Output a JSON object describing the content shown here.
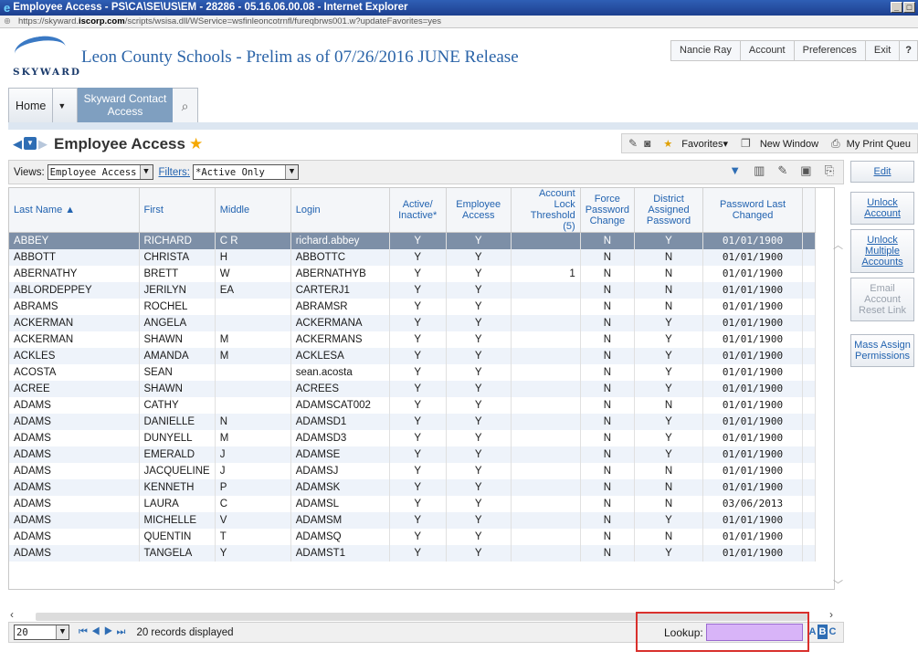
{
  "window": {
    "title": "Employee Access - PS\\CA\\SE\\US\\EM - 28286 - 05.16.06.00.08 - Internet Explorer"
  },
  "address": {
    "prefix": "https://skyward.",
    "domain": "iscorp.com",
    "path": "/scripts/wsisa.dll/WService=wsfinleoncotrnfl/fureqbrws001.w?updateFavorites=yes"
  },
  "brand": {
    "logo_text": "SKYWARD",
    "district": "Leon County Schools - Prelim as of 07/26/2016 JUNE Release"
  },
  "toplinks": {
    "user": "Nancie Ray",
    "account": "Account",
    "preferences": "Preferences",
    "exit": "Exit",
    "help": "?"
  },
  "nav": {
    "home": "Home",
    "tab": "Skyward Contact Access"
  },
  "page": {
    "title": "Employee Access"
  },
  "tools": {
    "favorites": "Favorites",
    "new_window": "New Window",
    "print_queue": "My Print Queu"
  },
  "views": {
    "views_label": "Views:",
    "view_value": "Employee Access",
    "filters_label": "Filters:",
    "filter_value": "*Active Only"
  },
  "columns": [
    "Last Name ▲",
    "First",
    "Middle",
    "Login",
    "Active/ Inactive*",
    "Employee Access",
    "Account Lock Threshold (5)",
    "Force Password Change",
    "District Assigned Password",
    "Password Last Changed"
  ],
  "rows": [
    [
      "ABBEY",
      "RICHARD",
      "C R",
      "richard.abbey",
      "Y",
      "Y",
      "",
      "N",
      "Y",
      "01/01/1900"
    ],
    [
      "ABBOTT",
      "CHRISTA",
      "H",
      "ABBOTTC",
      "Y",
      "Y",
      "",
      "N",
      "N",
      "01/01/1900"
    ],
    [
      "ABERNATHY",
      "BRETT",
      "W",
      "ABERNATHYB",
      "Y",
      "Y",
      "1",
      "N",
      "N",
      "01/01/1900"
    ],
    [
      "ABLORDEPPEY",
      "JERILYN",
      "EA",
      "CARTERJ1",
      "Y",
      "Y",
      "",
      "N",
      "N",
      "01/01/1900"
    ],
    [
      "ABRAMS",
      "ROCHEL",
      "",
      "ABRAMSR",
      "Y",
      "Y",
      "",
      "N",
      "N",
      "01/01/1900"
    ],
    [
      "ACKERMAN",
      "ANGELA",
      "",
      "ACKERMANA",
      "Y",
      "Y",
      "",
      "N",
      "Y",
      "01/01/1900"
    ],
    [
      "ACKERMAN",
      "SHAWN",
      "M",
      "ACKERMANS",
      "Y",
      "Y",
      "",
      "N",
      "Y",
      "01/01/1900"
    ],
    [
      "ACKLES",
      "AMANDA",
      "M",
      "ACKLESA",
      "Y",
      "Y",
      "",
      "N",
      "Y",
      "01/01/1900"
    ],
    [
      "ACOSTA",
      "SEAN",
      "",
      "sean.acosta",
      "Y",
      "Y",
      "",
      "N",
      "Y",
      "01/01/1900"
    ],
    [
      "ACREE",
      "SHAWN",
      "",
      "ACREES",
      "Y",
      "Y",
      "",
      "N",
      "Y",
      "01/01/1900"
    ],
    [
      "ADAMS",
      "CATHY",
      "",
      "ADAMSCAT002",
      "Y",
      "Y",
      "",
      "N",
      "N",
      "01/01/1900"
    ],
    [
      "ADAMS",
      "DANIELLE",
      "N",
      "ADAMSD1",
      "Y",
      "Y",
      "",
      "N",
      "Y",
      "01/01/1900"
    ],
    [
      "ADAMS",
      "DUNYELL",
      "M",
      "ADAMSD3",
      "Y",
      "Y",
      "",
      "N",
      "Y",
      "01/01/1900"
    ],
    [
      "ADAMS",
      "EMERALD",
      "J",
      "ADAMSE",
      "Y",
      "Y",
      "",
      "N",
      "Y",
      "01/01/1900"
    ],
    [
      "ADAMS",
      "JACQUELINE",
      "J",
      "ADAMSJ",
      "Y",
      "Y",
      "",
      "N",
      "N",
      "01/01/1900"
    ],
    [
      "ADAMS",
      "KENNETH",
      "P",
      "ADAMSK",
      "Y",
      "Y",
      "",
      "N",
      "N",
      "01/01/1900"
    ],
    [
      "ADAMS",
      "LAURA",
      "C",
      "ADAMSL",
      "Y",
      "Y",
      "",
      "N",
      "N",
      "03/06/2013"
    ],
    [
      "ADAMS",
      "MICHELLE",
      "V",
      "ADAMSM",
      "Y",
      "Y",
      "",
      "N",
      "Y",
      "01/01/1900"
    ],
    [
      "ADAMS",
      "QUENTIN",
      "T",
      "ADAMSQ",
      "Y",
      "Y",
      "",
      "N",
      "N",
      "01/01/1900"
    ],
    [
      "ADAMS",
      "TANGELA",
      "Y",
      "ADAMST1",
      "Y",
      "Y",
      "",
      "N",
      "Y",
      "01/01/1900"
    ]
  ],
  "footer": {
    "page_size": "20",
    "records": "20 records displayed",
    "lookup_label": "Lookup:",
    "lookup_value": "",
    "abc": [
      "A",
      "B",
      "C"
    ]
  },
  "side_buttons": {
    "edit": "Edit",
    "unlock": "Unlock Account",
    "unlock_multi": "Unlock Multiple Accounts",
    "email_reset": "Email Account Reset Link",
    "mass_assign": "Mass Assign Permissions"
  }
}
